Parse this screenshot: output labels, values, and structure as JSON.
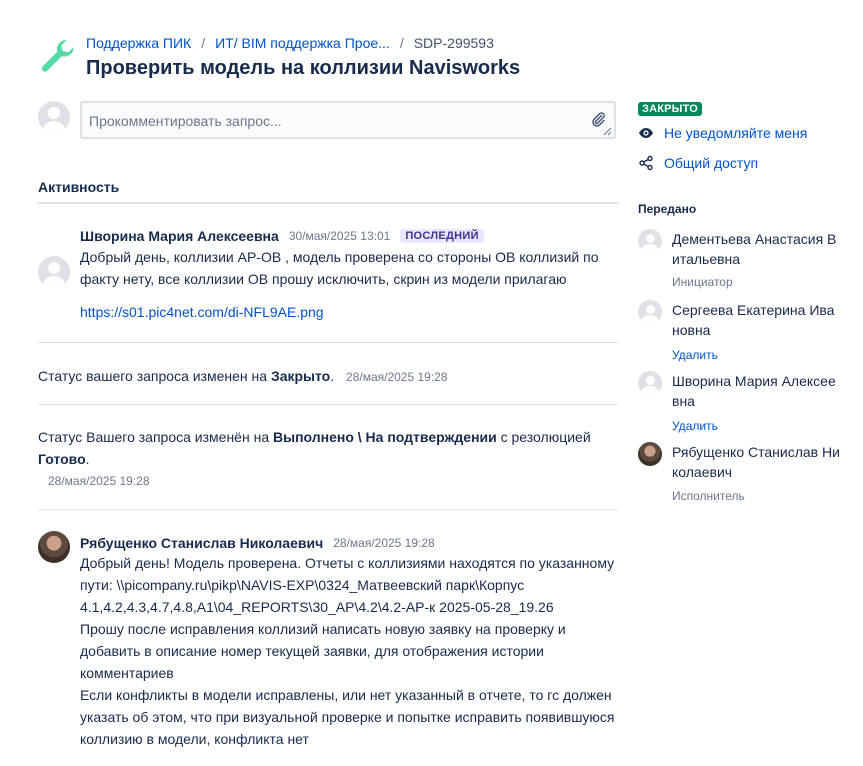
{
  "header": {
    "breadcrumb": [
      {
        "label": "Поддержка ПИК"
      },
      {
        "label": "ИТ/ BIM поддержка Прое..."
      },
      {
        "label": "SDP-299593"
      }
    ],
    "title": "Проверить модель на коллизии Navisworks"
  },
  "comment_input": {
    "placeholder": "Прокомментировать запрос..."
  },
  "activity": {
    "title": "Активность",
    "comment1": {
      "author": "Шворина Мария Алексеевна",
      "date": "30/мая/2025 13:01",
      "badge": "ПОСЛЕДНИЙ",
      "text": "Добрый день, коллизии АР-ОВ , модель проверена со стороны ОВ коллизий по факту нету, все коллизии ОВ прошу исключить, скрин из модели прилагаю",
      "link": "https://s01.pic4net.com/di-NFL9AE.png"
    },
    "status1": {
      "prefix": "Статус вашего запроса изменен на ",
      "status": "Закрыто",
      "suffix": ".",
      "date": "28/мая/2025 19:28"
    },
    "status2": {
      "prefix": "Статус Вашего запроса изменён на ",
      "status": "Выполнено \\ На подтверждении",
      "middle": " с резолюцией ",
      "resolution": "Готово",
      "suffix": ".",
      "date": "28/мая/2025 19:28"
    },
    "comment2": {
      "author": "Рябущенко Станислав Николаевич",
      "date": "28/мая/2025 19:28",
      "line1": "Добрый день! Модель проверена. Отчеты с коллизиями находятся по указанному",
      "line2": "пути: \\\\picompany.ru\\pikp\\NAVIS-EXP\\0324_Матвеевский парк\\Корпус",
      "line3": "4.1,4.2,4.3,4.7,4.8,А1\\04_REPORTS\\30_AP\\4.2\\4.2-АР-к 2025-05-28_19.26",
      "line4": "Прошу после исправления коллизий написать новую заявку на проверку и",
      "line5": "добавить в описание номер текущей заявки, для отображения истории",
      "line6": "комментариев",
      "line7": "Если конфликты в модели исправлены, или нет указанный в отчете, то гс должен",
      "line8": "указать об этом, что при визуальной проверке и попытке исправить появившуюся",
      "line9": "коллизию в модели, конфликта нет"
    }
  },
  "sidebar": {
    "status_badge": "ЗАКРЫТО",
    "notify": "Не уведомляйте меня",
    "share": "Общий доступ",
    "transferred_title": "Передано",
    "people": [
      {
        "name": "Дементьева Анастасия Витальевна",
        "role": "Инициатор"
      },
      {
        "name": "Сергеева Екатерина Ивановна",
        "action": "Удалить"
      },
      {
        "name": "Шворина Мария Алексеевна",
        "action": "Удалить"
      },
      {
        "name": "Рябущенко Станислав Николаевич",
        "role": "Исполнитель"
      }
    ]
  },
  "colors": {
    "accent": "#0052cc",
    "closed": "#00875a",
    "badge_last_bg": "#eae6ff",
    "wrench": "#57d9a3"
  }
}
